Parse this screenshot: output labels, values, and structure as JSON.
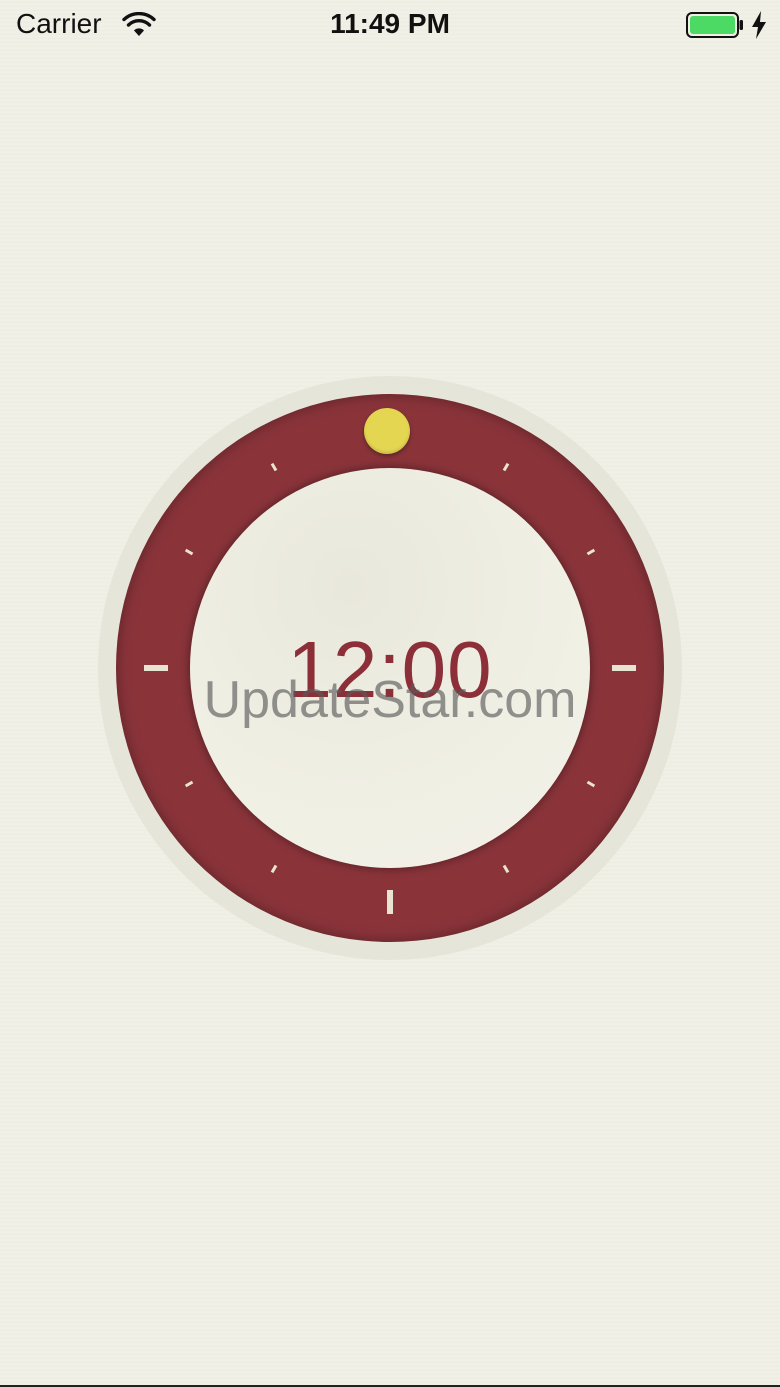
{
  "status_bar": {
    "carrier": "Carrier",
    "time": "11:49 PM",
    "wifi_icon": "wifi-icon",
    "battery_icon": "battery-icon",
    "charging_icon": "charging-bolt-icon",
    "battery_color": "#4cd964"
  },
  "timer": {
    "display": "12:00",
    "ring_color": "#8a343a",
    "handle_color": "#e5d652",
    "text_color": "#8c2f38"
  },
  "watermark": {
    "text": "UpdateStar.com"
  }
}
